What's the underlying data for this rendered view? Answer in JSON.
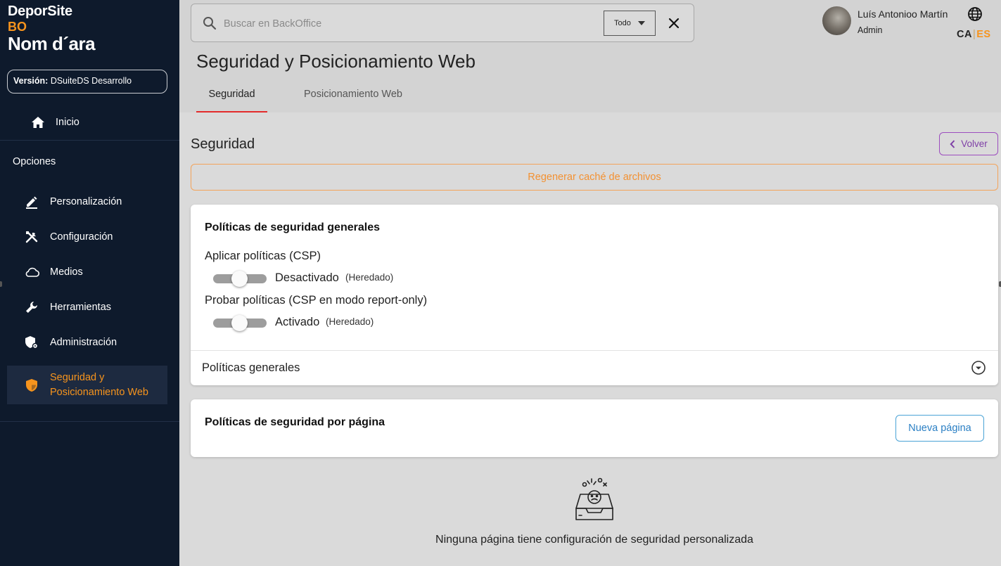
{
  "sidebar": {
    "brand_name": "DeporSite",
    "brand_sub": "BO",
    "site_name": "Nom d´ara",
    "version_label": "Versión:",
    "version_value": "DSuiteDS Desarrollo",
    "home_label": "Inicio",
    "options_label": "Opciones",
    "items": [
      {
        "label": "Personalización",
        "icon": "pencil-icon"
      },
      {
        "label": "Configuración",
        "icon": "tools-icon"
      },
      {
        "label": "Medios",
        "icon": "cloud-icon"
      },
      {
        "label": "Herramientas",
        "icon": "wrench-icon"
      },
      {
        "label": "Administración",
        "icon": "admin-shield-icon"
      },
      {
        "label_line1": "Seguridad y",
        "label_line2": "Posicionamiento Web",
        "icon": "security-shield-icon",
        "active": true
      }
    ]
  },
  "search": {
    "placeholder": "Buscar en BackOffice",
    "scope_value": "Todo"
  },
  "user": {
    "name": "Luís Antonioo Martín",
    "role": "Admin"
  },
  "languages": {
    "ca": "CA",
    "es": "ES",
    "active": "ES"
  },
  "page": {
    "title": "Seguridad y Posicionamiento Web",
    "tabs": [
      {
        "label": "Seguridad",
        "active": true
      },
      {
        "label": "Posicionamiento Web",
        "active": false
      }
    ]
  },
  "section": {
    "title": "Seguridad",
    "back_label": "Volver",
    "regen_label": "Regenerar caché de archivos"
  },
  "general_policies": {
    "title": "Políticas de seguridad generales",
    "apply_label": "Aplicar políticas (CSP)",
    "apply_state": "Desactivado",
    "apply_inherited": "(Heredado)",
    "test_label": "Probar políticas (CSP en modo report-only)",
    "test_state": "Activado",
    "test_inherited": "(Heredado)",
    "accordion_label": "Políticas generales"
  },
  "page_policies": {
    "title": "Políticas de seguridad por página",
    "new_button": "Nueva página",
    "empty_text": "Ninguna página tiene configuración de seguridad personalizada"
  },
  "colors": {
    "sidebar_bg": "#0e1a2c",
    "accent_orange": "#f7941d",
    "tab_underline": "#e32b2b",
    "back_button": "#9c4dbf",
    "new_button": "#2a7fc4"
  }
}
